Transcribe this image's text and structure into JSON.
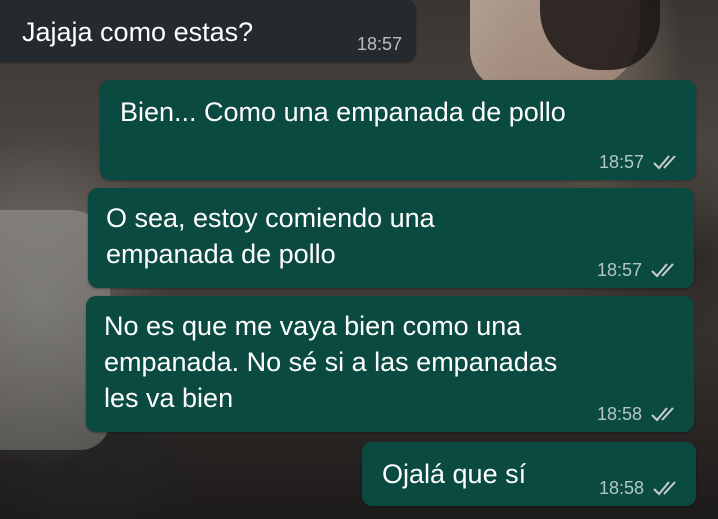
{
  "chat": {
    "messages": [
      {
        "direction": "in",
        "text": "Jajaja como estas?",
        "time": "18:57"
      },
      {
        "direction": "out",
        "text": "Bien... Como una empanada de pollo",
        "time": "18:57",
        "status_icon": "double-check-icon"
      },
      {
        "direction": "out",
        "text": "O sea, estoy comiendo una\nempanada de pollo",
        "time": "18:57",
        "status_icon": "double-check-icon"
      },
      {
        "direction": "out",
        "text": "No es que me vaya bien como una\nempanada. No sé si a las empanadas\nles va bien",
        "time": "18:58",
        "status_icon": "double-check-icon"
      },
      {
        "direction": "out",
        "text": "Ojalá que sí",
        "time": "18:58",
        "status_icon": "double-check-icon"
      }
    ]
  },
  "colors": {
    "incoming_bubble": "#242a2e",
    "outgoing_bubble": "#0b4a40",
    "text": "#ffffff",
    "timestamp": "#c7d0cd"
  }
}
